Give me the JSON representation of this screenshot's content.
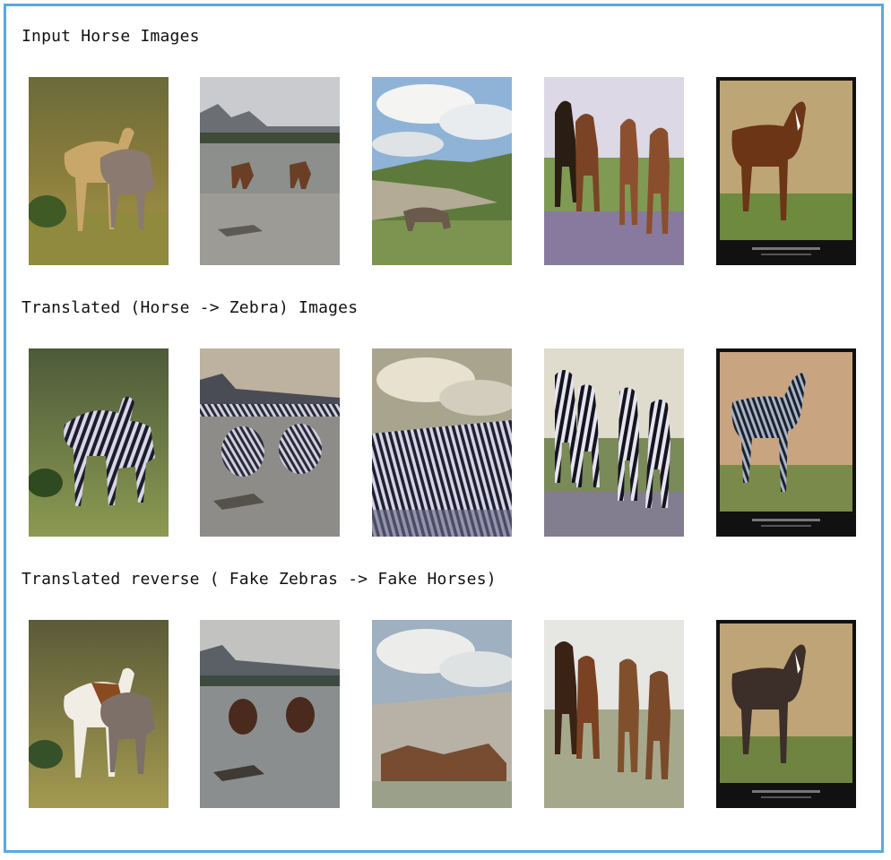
{
  "rows": [
    {
      "title": "Input Horse Images"
    },
    {
      "title": "Translated (Horse -> Zebra) Images"
    },
    {
      "title": "Translated reverse ( Fake Zebras -> Fake Horses)"
    }
  ],
  "colors": {
    "border": "#5aa8e0"
  }
}
